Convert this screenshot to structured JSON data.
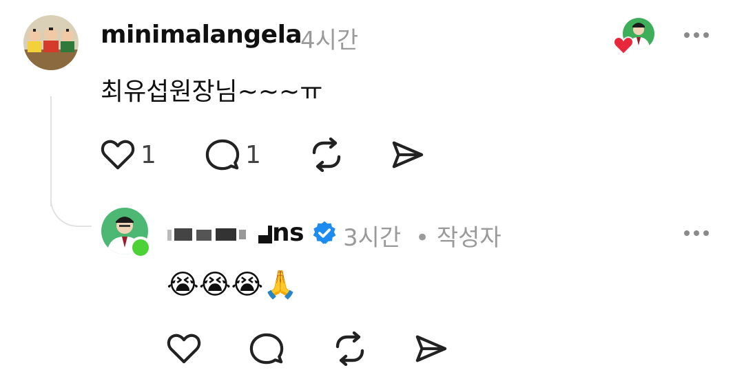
{
  "post": {
    "username": "minimalangela",
    "time": "4시간",
    "text": "최유섭원장님~~~ㅠ",
    "likes": "1",
    "replies": "1"
  },
  "reply": {
    "username_visible": "ns",
    "time": "3시간",
    "author_badge": "• 작성자",
    "text": "😭😭😭🙏"
  },
  "icons": {
    "like": "heart-icon",
    "comment": "comment-icon",
    "repost": "repost-icon",
    "share": "send-icon",
    "more": "more-horizontal-icon",
    "verified": "verified-badge-icon"
  },
  "colors": {
    "heart_red": "#e8273b",
    "verified_blue": "#1d8cf0",
    "online_green": "#4cd137",
    "muted": "#9a9a9a"
  }
}
